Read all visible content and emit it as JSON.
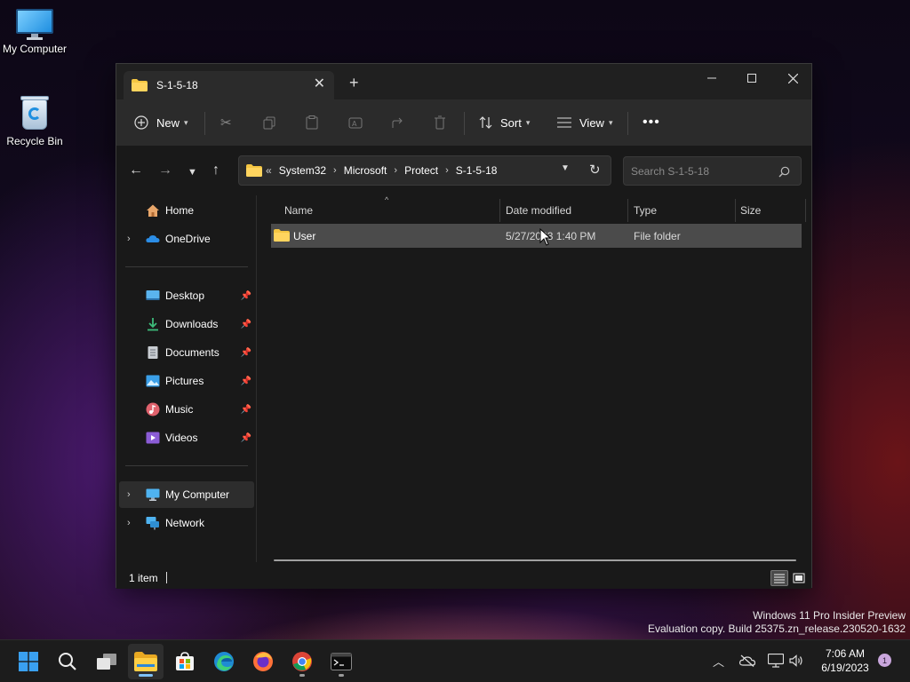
{
  "desktop": {
    "icons": [
      {
        "label": "My Computer",
        "icon": "monitor-icon"
      },
      {
        "label": "Recycle Bin",
        "icon": "recycle-bin-icon"
      }
    ]
  },
  "window": {
    "tab_title": "S-1-5-18",
    "new_tab_icon": "plus-icon",
    "controls": [
      "minimize",
      "maximize",
      "close"
    ]
  },
  "commandbar": {
    "new_label": "New",
    "sort_label": "Sort",
    "view_label": "View",
    "icons": [
      "cut-icon",
      "copy-icon",
      "paste-icon",
      "rename-icon",
      "share-icon",
      "delete-icon",
      "more-icon"
    ]
  },
  "address": {
    "overflow": "«",
    "crumbs": [
      "System32",
      "Microsoft",
      "Protect",
      "S-1-5-18"
    ],
    "search_placeholder": "Search S-1-5-18"
  },
  "nav": {
    "home": "Home",
    "onedrive": "OneDrive",
    "quick": [
      "Desktop",
      "Downloads",
      "Documents",
      "Pictures",
      "Music",
      "Videos"
    ],
    "my_computer": "My Computer",
    "network": "Network"
  },
  "columns": {
    "name": "Name",
    "date": "Date modified",
    "type": "Type",
    "size": "Size"
  },
  "rows": [
    {
      "name": "User",
      "date": "5/27/2023 1:40 PM",
      "type": "File folder",
      "size": ""
    }
  ],
  "status": {
    "count": "1 item"
  },
  "watermark": {
    "line1": "Windows 11 Pro Insider Preview",
    "line2": "Evaluation copy. Build 25375.zn_release.230520-1632"
  },
  "taskbar": {
    "apps": [
      "start",
      "search",
      "task-view",
      "file-explorer",
      "store",
      "edge",
      "firefox",
      "chrome",
      "terminal"
    ],
    "time": "7:06 AM",
    "date": "6/19/2023",
    "notifications": "1"
  },
  "colors": {
    "folder": "#f4c542",
    "accent": "#7ec0f5",
    "selection": "#4b4b4b"
  }
}
